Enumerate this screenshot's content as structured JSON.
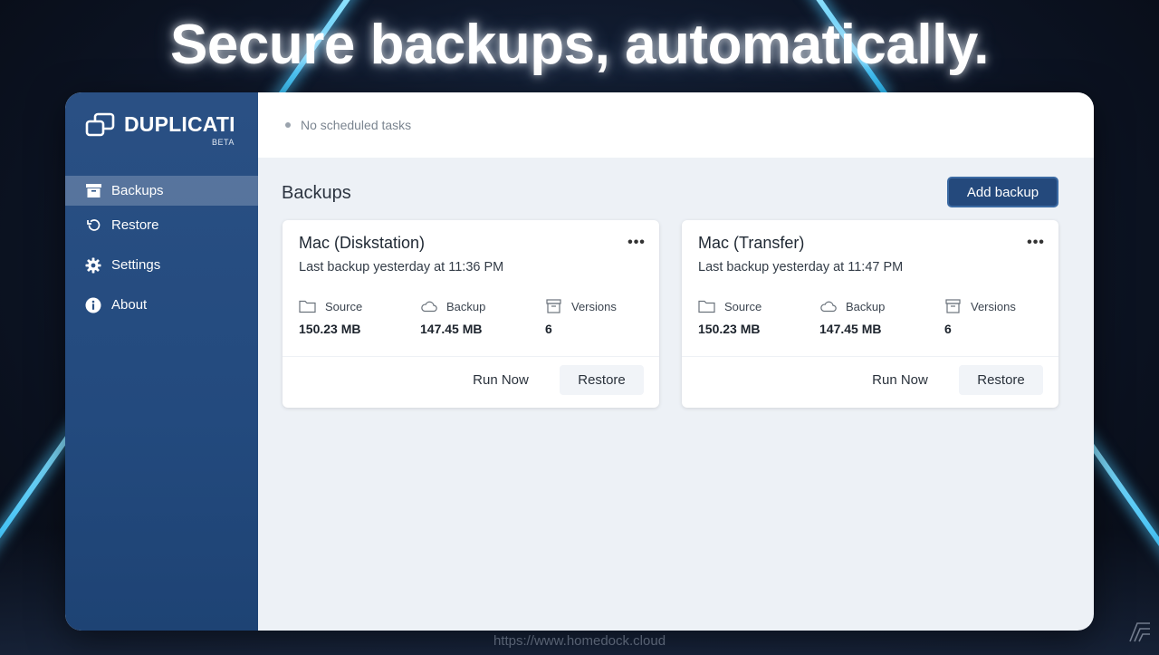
{
  "headline": "Secure backups, automatically.",
  "footer_url": "https://www.homedock.cloud",
  "colors": {
    "sidebar": "#234a7e",
    "accent_button": "#24497c",
    "background": "#edf1f6"
  },
  "brand": {
    "name": "DUPLICATI",
    "badge": "BETA",
    "icon": "duplicati-logo-icon"
  },
  "sidebar": {
    "items": [
      {
        "label": "Backups",
        "icon": "archive-box-icon",
        "active": true
      },
      {
        "label": "Restore",
        "icon": "restore-arrow-icon",
        "active": false
      },
      {
        "label": "Settings",
        "icon": "gear-icon",
        "active": false
      },
      {
        "label": "About",
        "icon": "info-icon",
        "active": false
      }
    ]
  },
  "topbar": {
    "status": "No scheduled tasks"
  },
  "main": {
    "title": "Backups",
    "add_button": "Add backup",
    "cards": [
      {
        "name": "Mac (Diskstation)",
        "last_backup": "Last backup yesterday at 11:36 PM",
        "stats": [
          {
            "label": "Source",
            "value": "150.23 MB",
            "icon": "folder-icon"
          },
          {
            "label": "Backup",
            "value": "147.45 MB",
            "icon": "cloud-icon"
          },
          {
            "label": "Versions",
            "value": "6",
            "icon": "archive-icon"
          }
        ],
        "run_label": "Run Now",
        "restore_label": "Restore"
      },
      {
        "name": "Mac (Transfer)",
        "last_backup": "Last backup yesterday at 11:47 PM",
        "stats": [
          {
            "label": "Source",
            "value": "150.23 MB",
            "icon": "folder-icon"
          },
          {
            "label": "Backup",
            "value": "147.45 MB",
            "icon": "cloud-icon"
          },
          {
            "label": "Versions",
            "value": "6",
            "icon": "archive-icon"
          }
        ],
        "run_label": "Run Now",
        "restore_label": "Restore"
      }
    ]
  }
}
